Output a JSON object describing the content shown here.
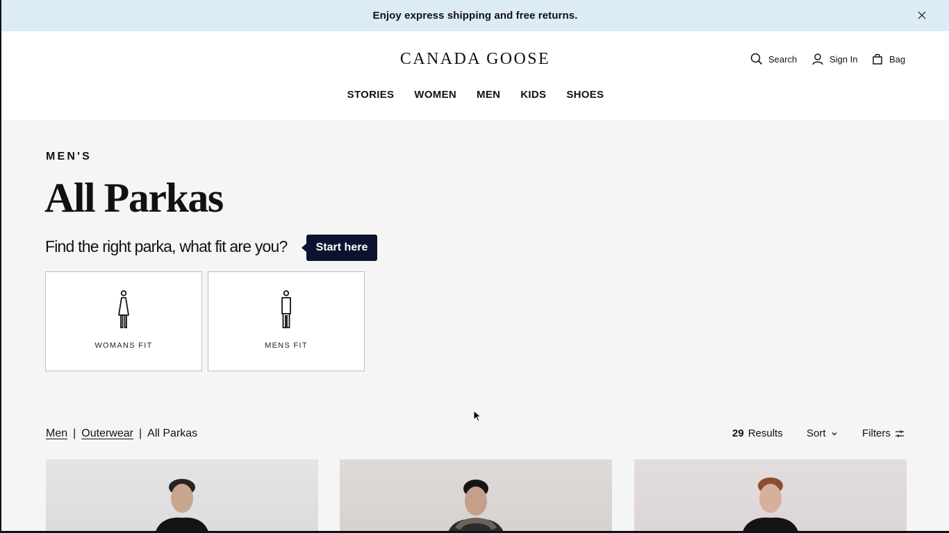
{
  "promo": {
    "text": "Enjoy express shipping and free returns."
  },
  "header": {
    "logo": "CANADA GOOSE",
    "search_label": "Search",
    "signin_label": "Sign In",
    "bag_label": "Bag"
  },
  "nav": {
    "items": [
      {
        "label": "STORIES"
      },
      {
        "label": "WOMEN"
      },
      {
        "label": "MEN"
      },
      {
        "label": "KIDS"
      },
      {
        "label": "SHOES"
      }
    ]
  },
  "page": {
    "eyebrow": "MEN'S",
    "title": "All Parkas",
    "fit_question": "Find the right parka, what fit are you?",
    "start_button": "Start here",
    "fit_options": [
      {
        "label": "WOMANS FIT",
        "icon": "woman-figure-icon"
      },
      {
        "label": "MENS FIT",
        "icon": "man-figure-icon"
      }
    ]
  },
  "breadcrumb": {
    "items": [
      {
        "label": "Men"
      },
      {
        "label": "Outerwear"
      },
      {
        "label": "All Parkas"
      }
    ],
    "separator": "|"
  },
  "toolbar": {
    "results_count": "29",
    "results_label": "Results",
    "sort_label": "Sort",
    "filters_label": "Filters"
  },
  "products": [
    {
      "image": "model-black-parka"
    },
    {
      "image": "model-black-parka-fur"
    },
    {
      "image": "model-black-parka-red-hair"
    }
  ],
  "colors": {
    "banner": "#dcecf6",
    "accent": "#0b1330",
    "background": "#f5f5f5"
  }
}
